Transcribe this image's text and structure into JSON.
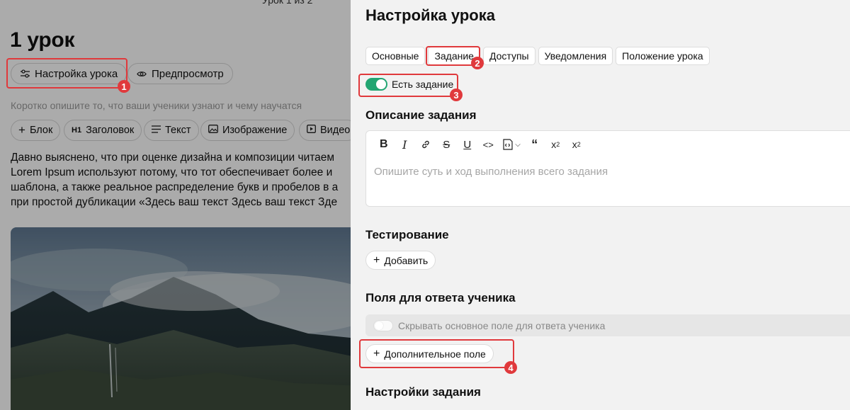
{
  "editor": {
    "pager": "Урок 1 из 2",
    "lesson_title": "1 урок",
    "settings_button": "Настройка урока",
    "preview_button": "Предпросмотр",
    "description_placeholder": "Коротко опишите то, что ваши ученики узнают и чему научатся",
    "tools": [
      {
        "label": "Блок",
        "icon": "plus-icon"
      },
      {
        "label": "Заголовок",
        "icon": "heading-icon"
      },
      {
        "label": "Текст",
        "icon": "text-icon"
      },
      {
        "label": "Изображение",
        "icon": "image-icon"
      },
      {
        "label": "Видео",
        "icon": "video-icon"
      }
    ],
    "body_lines": [
      "Давно выяснено, что при оценке дизайна и композиции читаем",
      "Lorem Ipsum используют потому, что тот обеспечивает более и",
      "шаблона, а также реальное распределение букв и пробелов в а",
      "при простой дубликации «Здесь ваш текст Здесь ваш текст Зде"
    ]
  },
  "panel": {
    "title": "Настройка урока",
    "tabs": [
      "Основные",
      "Задание",
      "Доступы",
      "Уведомления",
      "Положение урока"
    ],
    "active_tab": "Задание",
    "assignment_toggle_label": "Есть задание",
    "assignment_toggle_on": true,
    "description_heading": "Описание задания",
    "format_tools": [
      "bold-icon",
      "italic-icon",
      "link-icon",
      "strikethrough-icon",
      "underline-icon",
      "code-icon",
      "code-block-icon",
      "blockquote-icon",
      "superscript-icon",
      "subscript-icon"
    ],
    "description_placeholder": "Опишите суть и ход выполнения всего задания",
    "testing_heading": "Тестирование",
    "add_label": "Добавить",
    "answer_fields_heading": "Поля для ответа ученика",
    "hide_main_field_label": "Скрывать основное поле для ответа ученика",
    "hide_main_field_on": false,
    "extra_field_label": "Дополнительное поле",
    "task_settings_heading": "Настройки задания"
  },
  "annotations": [
    "1",
    "2",
    "3",
    "4"
  ],
  "colors": {
    "accent_green": "#22a572",
    "highlight_red": "#e0393c",
    "panel_bg": "#f2f2f2"
  }
}
